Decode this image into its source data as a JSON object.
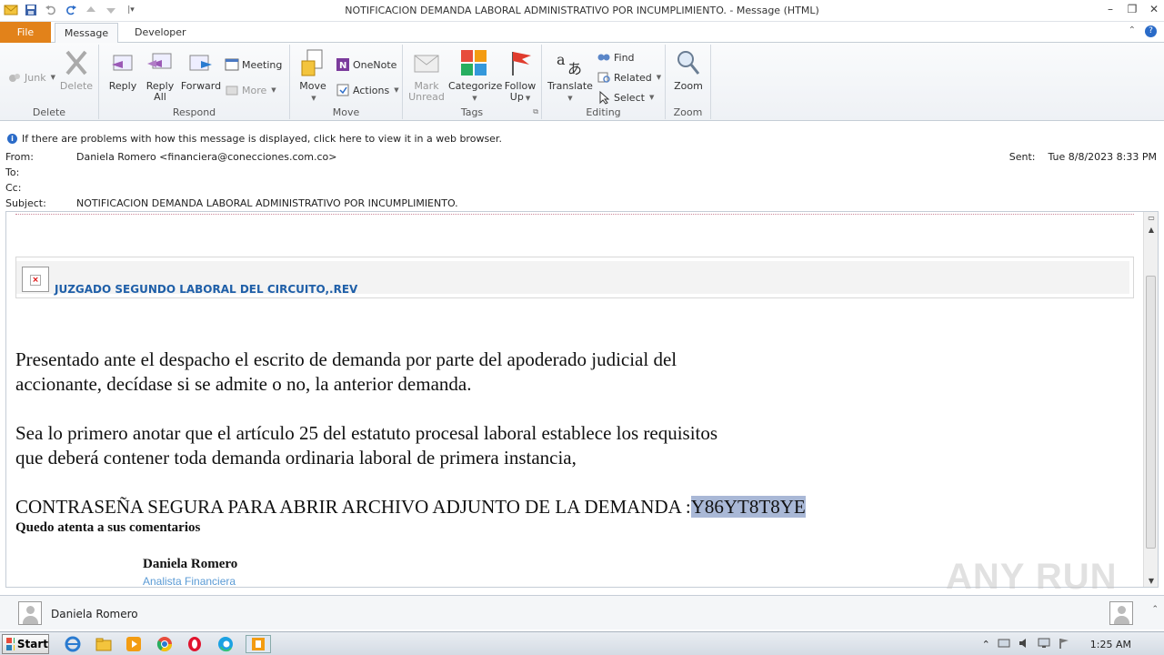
{
  "window": {
    "title": "NOTIFICACION DEMANDA LABORAL ADMINISTRATIVO POR INCUMPLIMIENTO. - Message (HTML)"
  },
  "tabs": {
    "file": "File",
    "message": "Message",
    "developer": "Developer"
  },
  "ribbon": {
    "delete_group": {
      "label": "Delete",
      "junk": "Junk",
      "delete": "Delete"
    },
    "respond_group": {
      "label": "Respond",
      "reply": "Reply",
      "reply_all_1": "Reply",
      "reply_all_2": "All",
      "forward": "Forward",
      "meeting": "Meeting",
      "more": "More"
    },
    "move_group": {
      "label": "Move",
      "move": "Move",
      "onenote": "OneNote",
      "actions": "Actions"
    },
    "tags_group": {
      "label": "Tags",
      "mark_unread_1": "Mark",
      "mark_unread_2": "Unread",
      "categorize": "Categorize",
      "follow_up_1": "Follow",
      "follow_up_2": "Up"
    },
    "editing_group": {
      "label": "Editing",
      "translate": "Translate",
      "find": "Find",
      "related": "Related",
      "select": "Select"
    },
    "zoom_group": {
      "label": "Zoom",
      "zoom": "Zoom"
    }
  },
  "infobar": {
    "text": "If there are problems with how this message is displayed, click here to view it in a web browser."
  },
  "header": {
    "from_label": "From:",
    "from_value": "Daniela Romero <financiera@conecciones.com.co>",
    "to_label": "To:",
    "cc_label": "Cc:",
    "subject_label": "Subject:",
    "subject_value": "NOTIFICACION DEMANDA LABORAL ADMINISTRATIVO POR INCUMPLIMIENTO.",
    "sent_label": "Sent:",
    "sent_value": "Tue 8/8/2023 8:33 PM"
  },
  "body": {
    "court_title": "JUZGADO SEGUNDO LABORAL DEL CIRCUITO,.REV",
    "p1_line1": "Presentado ante el despacho el escrito de demanda por parte del apoderado judicial del",
    "p1_line2": "accionante, decídase si se admite o no, la anterior demanda.",
    "p2_line1": "Sea lo primero anotar que el artículo 25 del estatuto procesal laboral establece los requisitos",
    "p2_line2": "que deberá contener toda demanda ordinaria laboral de primera instancia,",
    "password_prefix": "CONTRASEÑA SEGURA PARA ABRIR ARCHIVO ADJUNTO DE LA DEMANDA :",
    "password_value": "Y86YT8T8YE",
    "closing": "Quedo atenta a sus comentarios",
    "signature_name": "Daniela Romero",
    "signature_role": "Analista Financiera"
  },
  "people_pane": {
    "name": "Daniela Romero"
  },
  "watermark": "ANY RUN",
  "taskbar": {
    "start": "Start",
    "clock": "1:25 AM"
  }
}
